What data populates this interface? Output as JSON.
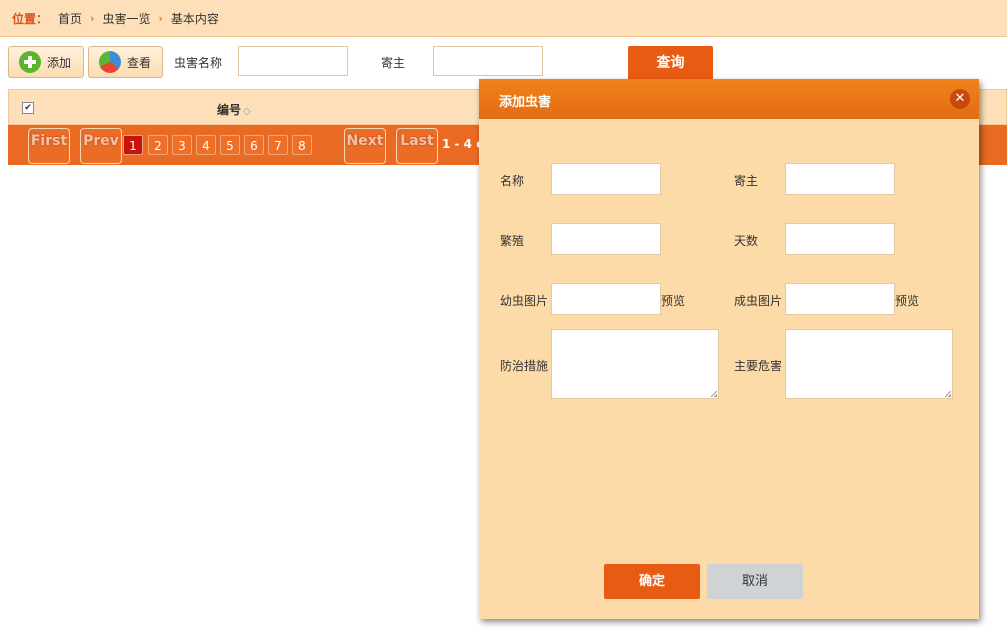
{
  "breadcrumb": {
    "label": "位置：",
    "items": [
      "首页",
      "虫害一览",
      "基本内容"
    ]
  },
  "toolbar": {
    "add_label": "添加",
    "view_label": "查看",
    "pest_name_label": "虫害名称",
    "host_label": "寄主",
    "query_label": "查询",
    "pest_name_value": "",
    "host_value": ""
  },
  "table": {
    "header_number": "编号",
    "sort_icon": "sort-icon"
  },
  "pager": {
    "first": "First",
    "prev": "Prev",
    "pages": [
      "1",
      "2",
      "3",
      "4",
      "5",
      "6",
      "7",
      "8"
    ],
    "active_page": "1",
    "next": "Next",
    "last": "Last",
    "info": "1 - 4 c"
  },
  "modal": {
    "title": "添加虫害",
    "close_icon": "close-icon",
    "fields": {
      "name": "名称",
      "host": "寄主",
      "breed": "繁殖",
      "days": "天数",
      "larva_image": "幼虫图片",
      "adult_image": "成虫图片",
      "preview": "预览",
      "control": "防治措施",
      "harm": "主要危害"
    },
    "ok_label": "确定",
    "cancel_label": "取消"
  },
  "colors": {
    "accent": "#e85b12",
    "panel": "#fddba8",
    "header_bg": "#fde0ba"
  }
}
